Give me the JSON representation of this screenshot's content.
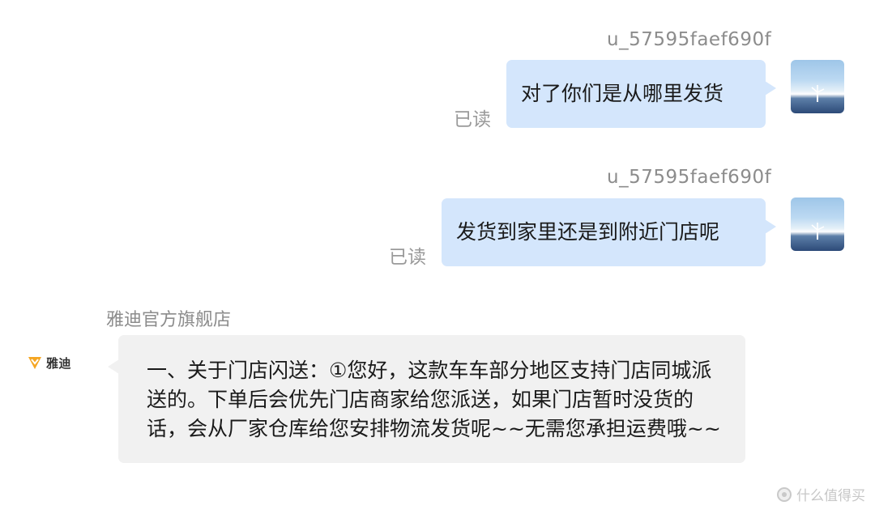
{
  "messages": [
    {
      "sender": "u_57595faef690f",
      "direction": "outgoing",
      "text": "对了你们是从哪里发货",
      "read_status": "已读",
      "avatar_icon": "landscape-avatar-icon"
    },
    {
      "sender": "u_57595faef690f",
      "direction": "outgoing",
      "text": "发货到家里还是到附近门店呢",
      "read_status": "已读",
      "avatar_icon": "landscape-avatar-icon"
    },
    {
      "sender": "雅迪官方旗舰店",
      "direction": "incoming",
      "logo_text": "雅迪",
      "logo_icon": "yadea-logo-icon",
      "text": "一、关于门店闪送：①您好，这款车车部分地区支持门店同城派送的。下单后会优先门店商家给您派送，如果门店暂时没货的话，会从厂家仓库给您安排物流发货呢~~无需您承担运费哦~~"
    }
  ],
  "watermark": {
    "text": "什么值得买",
    "icon": "zhidemai-logo-icon"
  },
  "colors": {
    "outgoing_bubble": "#d4e6fc",
    "incoming_bubble": "#f1f1f1",
    "meta_text": "#8c8c8c",
    "logo_accent": "#f5a623"
  }
}
